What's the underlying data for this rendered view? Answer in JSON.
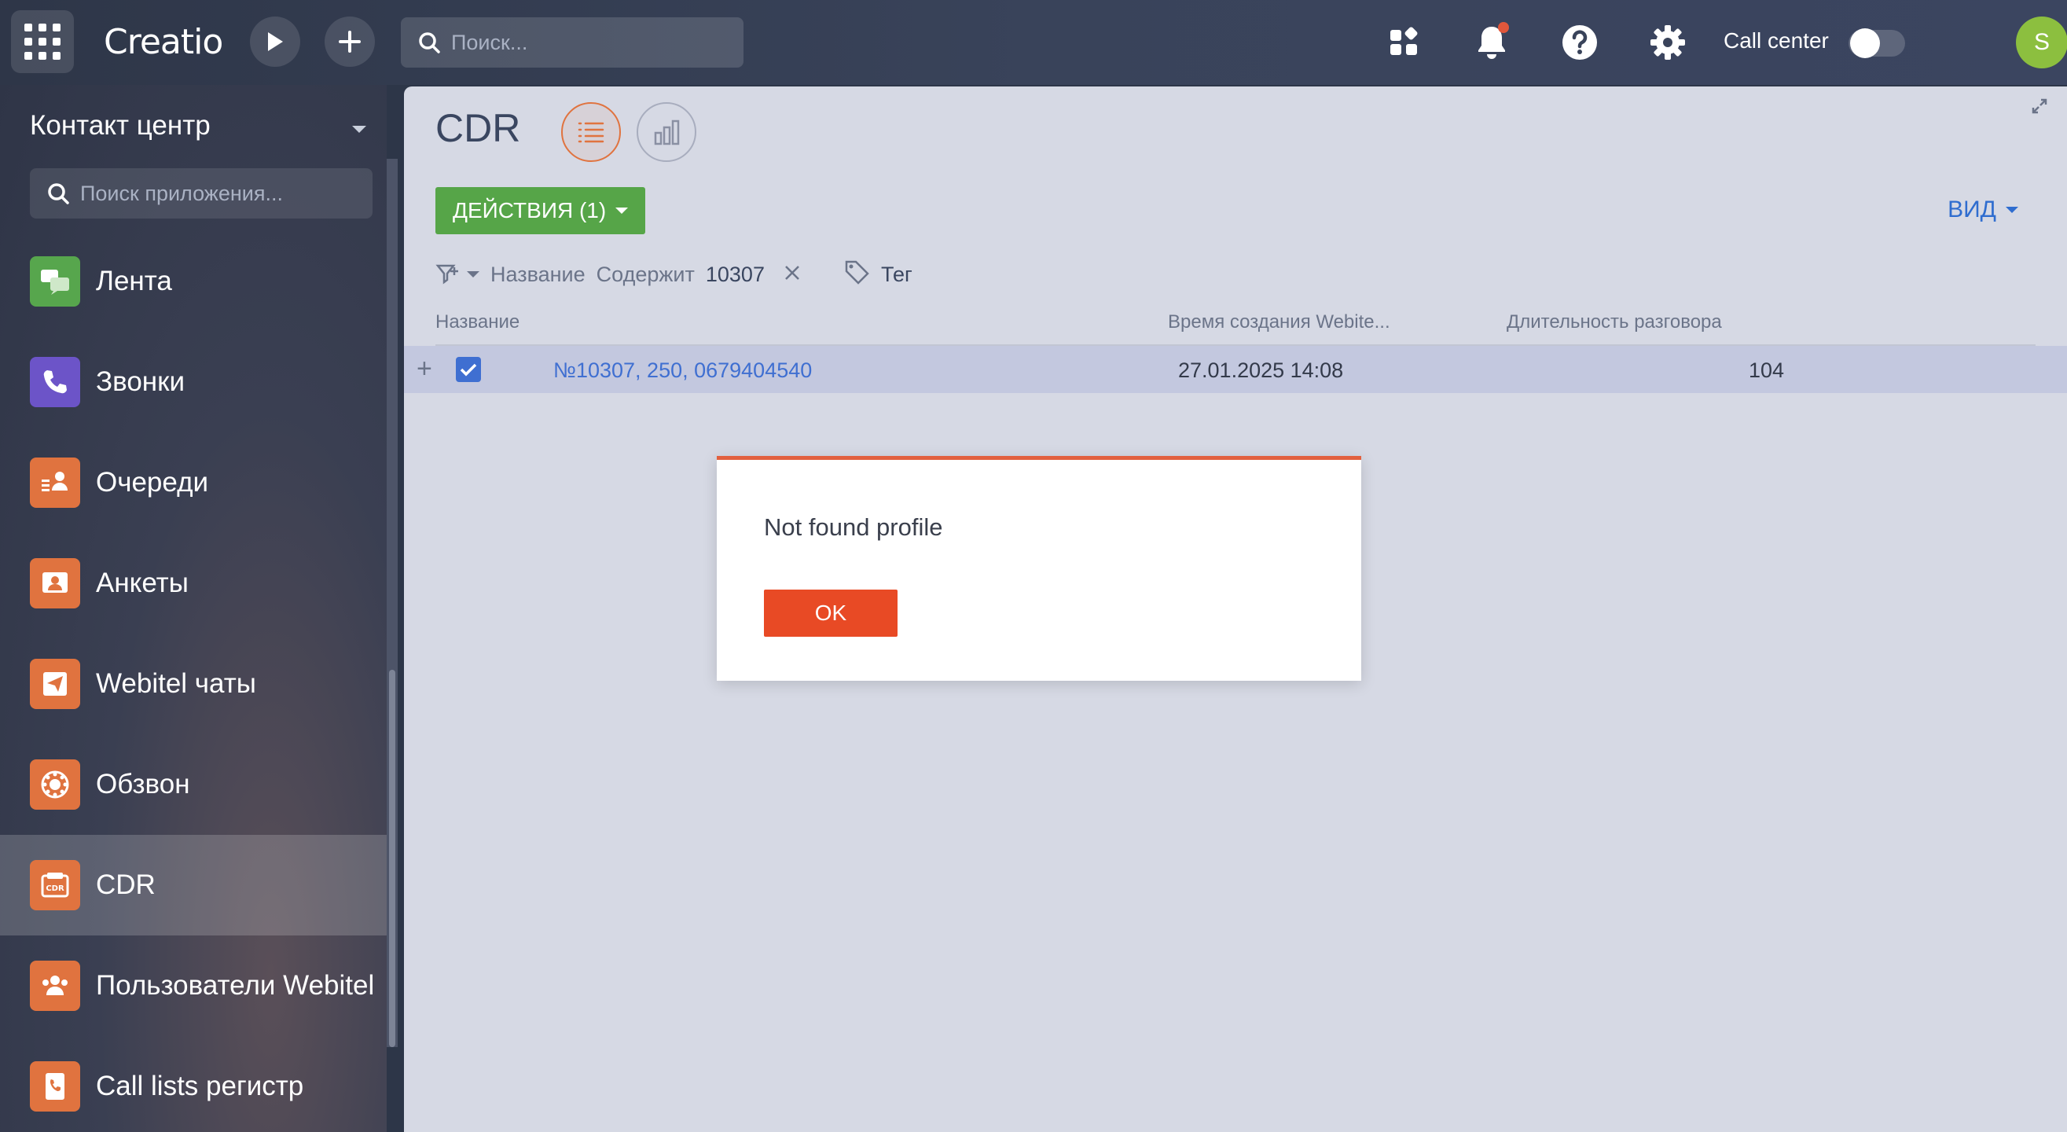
{
  "topbar": {
    "logo": "Creatio",
    "search_placeholder": "Поиск...",
    "call_center_label": "Call center",
    "avatar_initial": "S"
  },
  "sidebar": {
    "workspace": "Контакт центр",
    "search_placeholder": "Поиск приложения...",
    "items": [
      {
        "label": "Лента",
        "icon": "chat-bubbles-icon",
        "color": "#57a64d"
      },
      {
        "label": "Звонки",
        "icon": "phone-icon",
        "color": "#6c54c8"
      },
      {
        "label": "Очереди",
        "icon": "queue-icon",
        "color": "#e0733f"
      },
      {
        "label": "Анкеты",
        "icon": "survey-icon",
        "color": "#e0733f"
      },
      {
        "label": "Webitel чаты",
        "icon": "send-icon",
        "color": "#e0733f"
      },
      {
        "label": "Обзвон",
        "icon": "dialer-icon",
        "color": "#e0733f"
      },
      {
        "label": "CDR",
        "icon": "cdr-icon",
        "color": "#e0733f"
      },
      {
        "label": "Пользователи Webitel",
        "icon": "users-icon",
        "color": "#e0733f"
      },
      {
        "label": "Call lists регистр",
        "icon": "call-list-icon",
        "color": "#e0733f"
      }
    ]
  },
  "main": {
    "title": "CDR",
    "actions_label": "ДЕЙСТВИЯ (1)",
    "view_label": "ВИД",
    "filter": {
      "field": "Название",
      "operator": "Содержит",
      "value": "10307",
      "tag_label": "Тег"
    },
    "columns": [
      "Название",
      "Время создания Webite...",
      "Длительность разговора"
    ],
    "rows": [
      {
        "name": "№10307, 250, 0679404540",
        "created": "27.01.2025 14:08",
        "duration": "104",
        "selected": true
      }
    ]
  },
  "modal": {
    "message": "Not found profile",
    "ok_label": "OK"
  }
}
